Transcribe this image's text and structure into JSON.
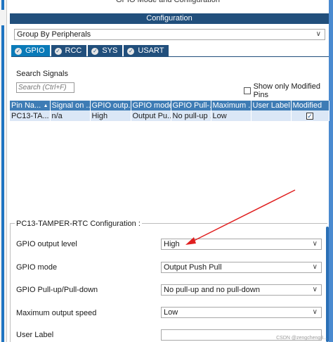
{
  "header": {
    "window_title": "GPIO Mode and Configuration",
    "section_title": "Configuration"
  },
  "group_by": {
    "value": "Group By Peripherals"
  },
  "tabs": [
    {
      "label": "GPIO",
      "active": true
    },
    {
      "label": "RCC",
      "active": false
    },
    {
      "label": "SYS",
      "active": false
    },
    {
      "label": "USART",
      "active": false
    }
  ],
  "search": {
    "label": "Search Signals",
    "placeholder": "Search (Ctrl+F)",
    "show_modified_label": "Show only Modified Pins",
    "show_modified_checked": false
  },
  "table": {
    "columns": [
      "Pin Na...",
      "Signal on ...",
      "GPIO outp...",
      "GPIO mode",
      "GPIO Pull-...",
      "Maximum ...",
      "User Label",
      "Modified"
    ],
    "rows": [
      [
        "PC13-TA...",
        "n/a",
        "High",
        "Output Pu...",
        "No pull-up ...",
        "Low",
        "",
        ""
      ]
    ],
    "row_modified": [
      true
    ]
  },
  "config_panel": {
    "title": "PC13-TAMPER-RTC Configuration :",
    "fields": [
      {
        "label": "GPIO output level",
        "value": "High",
        "type": "dropdown"
      },
      {
        "label": "GPIO mode",
        "value": "Output Push Pull",
        "type": "dropdown"
      },
      {
        "label": "GPIO Pull-up/Pull-down",
        "value": "No pull-up and no pull-down",
        "type": "dropdown"
      },
      {
        "label": "Maximum output speed",
        "value": "Low",
        "type": "dropdown"
      },
      {
        "label": "User Label",
        "value": "",
        "type": "text"
      }
    ]
  },
  "annotation_color": "#e02020",
  "watermark": "CSDN @zengcheng8..."
}
